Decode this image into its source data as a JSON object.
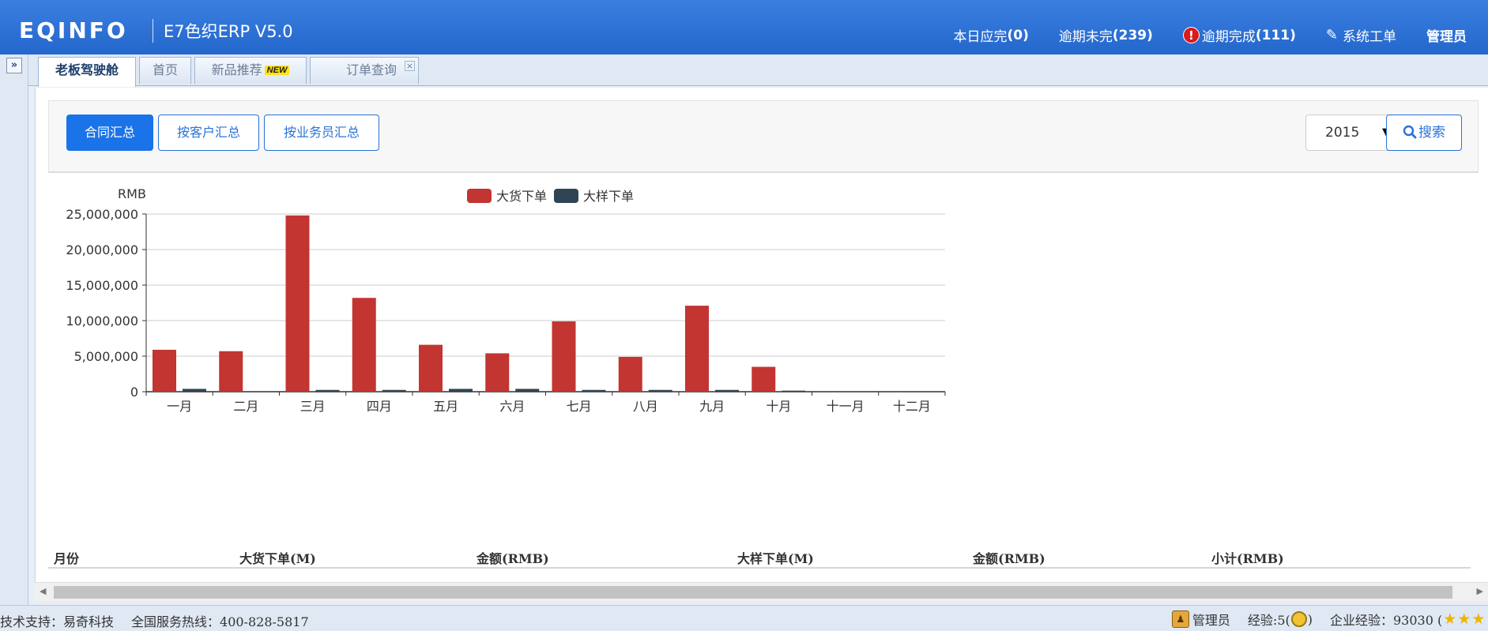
{
  "header": {
    "logo": "EQINFO",
    "product": "E7色织ERP V5.0",
    "nav": [
      {
        "label": "本日应完",
        "count": "(0)"
      },
      {
        "label": "逾期未完",
        "count": "(239)"
      },
      {
        "label": "逾期完成",
        "count": "(111)"
      },
      {
        "label": "系统工单",
        "count": ""
      },
      {
        "label": "管理员",
        "count": ""
      }
    ]
  },
  "tabs": [
    {
      "label": "老板驾驶舱",
      "active": true
    },
    {
      "label": "首页"
    },
    {
      "label": "新品推荐",
      "badge": "NEW"
    },
    {
      "label": "订单查询",
      "closable": true
    }
  ],
  "toolbar": {
    "buttons": [
      "合同汇总",
      "按客户汇总",
      "按业务员汇总"
    ],
    "year": "2015",
    "search_label": "搜索"
  },
  "chart_data": {
    "type": "bar",
    "unit_label": "RMB",
    "categories": [
      "一月",
      "二月",
      "三月",
      "四月",
      "五月",
      "六月",
      "七月",
      "八月",
      "九月",
      "十月",
      "十一月",
      "十二月"
    ],
    "series": [
      {
        "name": "大货下单",
        "color": "#c23531",
        "values": [
          5900000,
          5700000,
          24800000,
          13200000,
          6600000,
          5400000,
          9900000,
          4900000,
          12100000,
          3500000,
          0,
          0
        ]
      },
      {
        "name": "大样下单",
        "color": "#2f4554",
        "values": [
          400000,
          0,
          250000,
          250000,
          400000,
          400000,
          250000,
          250000,
          250000,
          150000,
          0,
          0
        ]
      }
    ],
    "ylim": [
      0,
      25000000
    ],
    "yticks": [
      "0",
      "5,000,000",
      "10,000,000",
      "15,000,000",
      "20,000,000",
      "25,000,000"
    ],
    "grid": true,
    "legend_position": "top-center"
  },
  "table": {
    "headers": [
      "月份",
      "大货下单(M)",
      "金额(RMB)",
      "大样下单(M)",
      "金额(RMB)",
      "小计(RMB)"
    ]
  },
  "statusbar": {
    "support": "技术支持：易奇科技",
    "hotline": "全国服务热线：400-828-5817",
    "user": "管理员",
    "exp_label": "经验:5(",
    "exp_close": ")",
    "corp_exp": "企业经验：93030 ("
  }
}
